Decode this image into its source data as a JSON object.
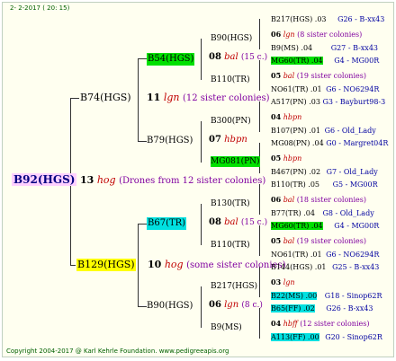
{
  "header": {
    "date": "2-  2-2017 ( 20: 15)"
  },
  "footer": {
    "copyright": "Copyright 2004-2017 @ Karl Kehrle Foundation.  www.pedigreeapis.org"
  },
  "colors": {
    "green": "#00e000",
    "cyan": "#00e0e0",
    "yellow": "#ffff00",
    "pink": "#ffd0ff",
    "red": "#c00000",
    "blue": "#0000a0"
  },
  "tree": {
    "root": {
      "label": "B92(HGS)",
      "num": "13",
      "breed": "hog",
      "note": "(Drones from 12 sister colonies)"
    },
    "sire": {
      "label": "B74(HGS)",
      "num": "11",
      "breed": "lgn",
      "note": "(12 sister colonies)"
    },
    "dam": {
      "label": "B129(HGS)",
      "num": "10",
      "breed": "hog",
      "note": "(some sister colonies)"
    },
    "ss": {
      "label": "B54(HGS)",
      "num": "08",
      "breed": "bal",
      "note": "(15 c.)"
    },
    "sd": {
      "label": "B79(HGS)",
      "num": "07",
      "breed": "hbpn"
    },
    "ds": {
      "label": "B67(TR)",
      "num": "08",
      "breed": "bal",
      "note": "(15 c.)"
    },
    "dd": {
      "label": "B90(HGS)",
      "num": "06",
      "breed": "lgn",
      "note": "(8 c.)"
    },
    "g3": [
      {
        "label": "B90(HGS)"
      },
      {
        "label": "B110(TR)"
      },
      {
        "label": "B300(PN)"
      },
      {
        "label": "MG081(PN)"
      },
      {
        "label": "B130(TR)"
      },
      {
        "label": "B110(TR)"
      },
      {
        "label": "B217(HGS)"
      },
      {
        "label": "B9(MS)"
      }
    ],
    "g4": [
      {
        "top": "B217(HGS) .03",
        "topref": "G26 - B-xx43",
        "num": "06",
        "breed": "lgn",
        "note": "(8 sister colonies)",
        "bot": "B9(MS) .04",
        "botref": "G27 - B-xx43"
      },
      {
        "top": "MG60(TR) .04",
        "topref": "G4 - MG00R",
        "num": "05",
        "breed": "bal",
        "note": "(19 sister colonies)",
        "bot": "NO61(TR) .01",
        "botref": "G6 - NO6294R"
      },
      {
        "top": "A517(PN) .03",
        "topref": "G3 - Bayburt98-3",
        "num": "04",
        "breed": "hbpn",
        "note": "",
        "bot": "B107(PN) .01",
        "botref": "G6 - Old_Lady"
      },
      {
        "top": "MG08(PN) .04",
        "topref": "G0 - Margret04R",
        "num": "05",
        "breed": "hbpn",
        "note": "",
        "bot": "B467(PN) .02",
        "botref": "G7 - Old_Lady"
      },
      {
        "top": "B110(TR) .05",
        "topref": "G5 - MG00R",
        "num": "06",
        "breed": "bal",
        "note": "(18 sister colonies)",
        "bot": "B77(TR) .04",
        "botref": "G8 - Old_Lady"
      },
      {
        "top": "MG60(TR) .04",
        "topref": "G4 - MG00R",
        "num": "05",
        "breed": "bal",
        "note": "(19 sister colonies)",
        "bot": "NO61(TR) .01",
        "botref": "G6 - NO6294R"
      },
      {
        "top": "B144(HGS) .01",
        "topref": "G25 - B-xx43",
        "num": "03",
        "breed": "lgn",
        "note": "",
        "bot": "B22(MS) .00",
        "botref": "G18 - Sinop62R"
      },
      {
        "top": "B65(FF) .02",
        "topref": "G26 - B-xx43",
        "num": "04",
        "breed": "hbff",
        "note": "(12 sister colonies)",
        "bot": "A113(FF) .00",
        "botref": "G20 - Sinop62R"
      }
    ]
  }
}
